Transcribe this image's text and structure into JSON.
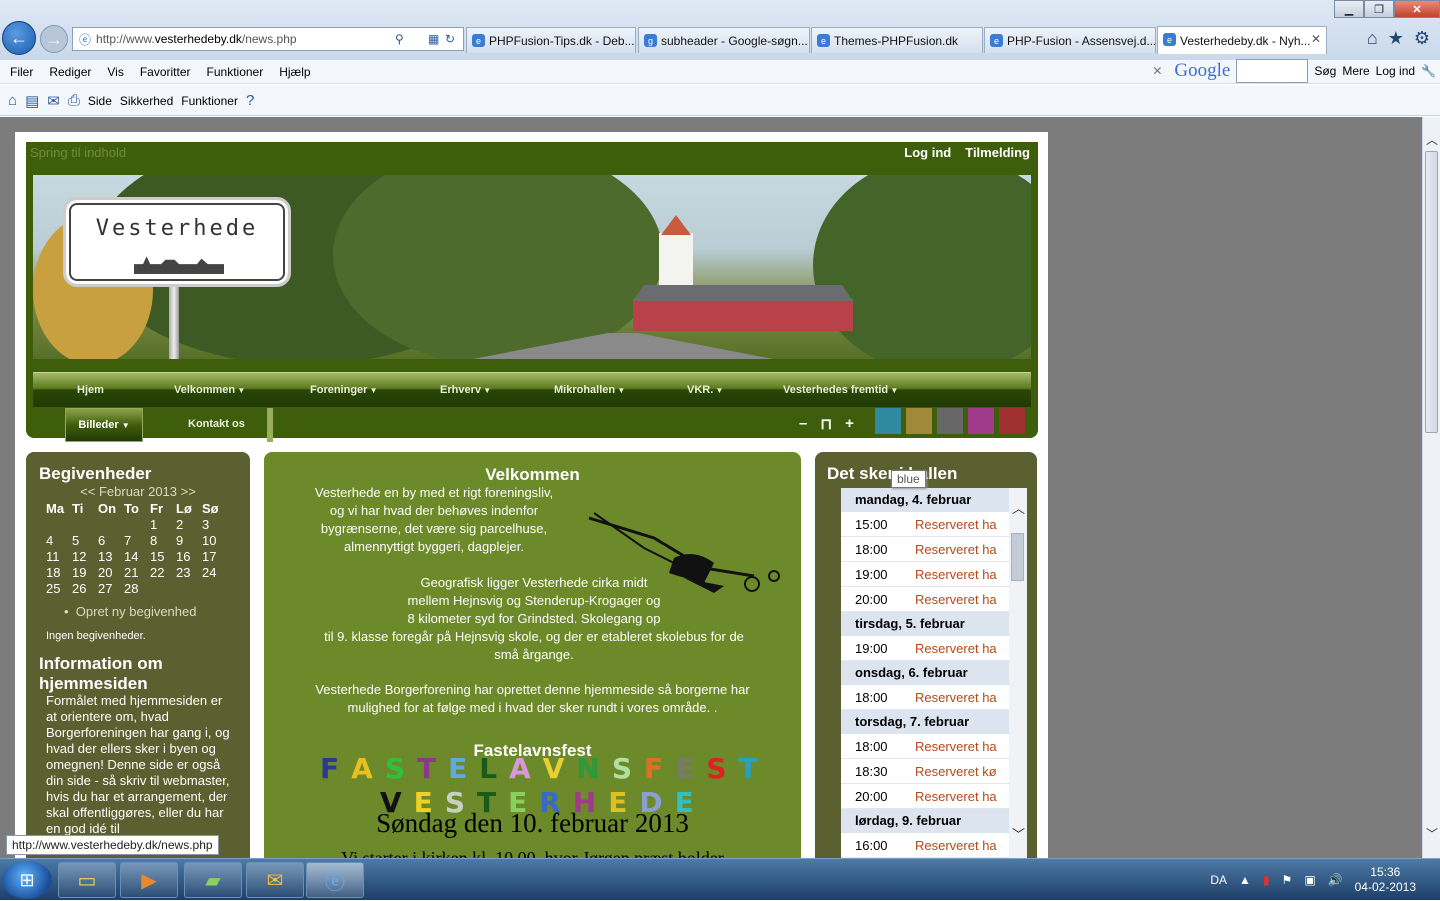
{
  "browser": {
    "address": {
      "prefix": "http://www.",
      "host": "vesterhedeby.dk",
      "path": "/news.php"
    },
    "tabs": [
      {
        "label": "PHPFusion-Tips.dk - Deb...",
        "icon": "ie-page-icon",
        "active": false
      },
      {
        "label": "subheader - Google-søgn...",
        "icon": "google-icon",
        "active": false
      },
      {
        "label": "Themes-PHPFusion.dk",
        "icon": "ie-page-icon",
        "active": false
      },
      {
        "label": "PHP-Fusion - Assensvej.d...",
        "icon": "php-fusion-icon",
        "active": false
      },
      {
        "label": "Vesterhedeby.dk - Nyh...",
        "icon": "ie-page-icon",
        "active": true
      }
    ],
    "menu": [
      "Filer",
      "Rediger",
      "Vis",
      "Favoritter",
      "Funktioner",
      "Hjælp"
    ],
    "google_bar": {
      "logo": "Google",
      "search": "Søg",
      "more": "Mere",
      "login": "Log ind"
    },
    "command_bar": [
      "Side",
      "Sikkerhed",
      "Funktioner"
    ],
    "status_url": "http://www.vesterhedeby.dk/news.php",
    "tooltip": "blue"
  },
  "site": {
    "skip_link": "Spring til indhold",
    "login": "Log ind",
    "register": "Tilmelding",
    "sign_text": "Vesterhede",
    "nav": [
      "Hjem",
      "Velkommen",
      "Foreninger",
      "Erhverv",
      "Mikrohallen",
      "VKR.",
      "Vesterhedes fremtid"
    ],
    "nav2": [
      "Billeder",
      "Kontakt os"
    ],
    "font_controls": [
      "–",
      "⊓",
      "+"
    ],
    "swatches": [
      "#2f8aa0",
      "#a08a3a",
      "#666666",
      "#a03a8a",
      "#a03030"
    ]
  },
  "left": {
    "events_title": "Begivenheder",
    "cal_nav": "<< Februar 2013 >>",
    "weekdays": [
      "Ma",
      "Ti",
      "On",
      "To",
      "Fr",
      "Lø",
      "Sø"
    ],
    "weeks": [
      [
        "",
        "",
        "",
        "",
        "1",
        "2",
        "3"
      ],
      [
        "4",
        "5",
        "6",
        "7",
        "8",
        "9",
        "10"
      ],
      [
        "11",
        "12",
        "13",
        "14",
        "15",
        "16",
        "17"
      ],
      [
        "18",
        "19",
        "20",
        "21",
        "22",
        "23",
        "24"
      ],
      [
        "25",
        "26",
        "27",
        "28",
        "",
        "",
        ""
      ]
    ],
    "new_event": "Opret ny begivenhed",
    "no_events": "Ingen begivenheder.",
    "info_title": "Information om hjemmesiden",
    "info_text": "Formålet med hjemmesiden er at orientere om, hvad Borgerforeningen har gang i, og hvad der ellers sker i byen og omegnen! Denne side er også din side - så skriv til webmaster, hvis du har et arrangement, der skal offentliggøres, eller du har en god idé til"
  },
  "center": {
    "title": "Velkommen",
    "p1": [
      "Vesterhede en by med et rigt foreningsliv,",
      "og vi har hvad der behøves indenfor",
      "bygrænserne, det være sig parcelhuse,",
      "almennyttigt byggeri, dagplejer."
    ],
    "p2": [
      "Geografisk ligger Vesterhede cirka midt",
      "mellem Hejnsvig og Stenderup-Krogager og",
      "8 kilometer syd for Grindsted. Skolegang op",
      "til 9. klasse foregår på Hejnsvig skole, og der er etableret skolebus for de",
      "små årgange."
    ],
    "p3": [
      "Vesterhede Borgerforening har oprettet denne hjemmeside så borgerne har",
      "mulighed for at følge med i hvad der sker rundt i vores område. ."
    ],
    "fest_heading": "Fastelavnsfest",
    "fest_line1": [
      {
        "c": "F",
        "col": "#2b3a8c"
      },
      {
        "c": "A",
        "col": "#e8c020"
      },
      {
        "c": "S",
        "col": "#30c040"
      },
      {
        "c": "T",
        "col": "#8a3a8a"
      },
      {
        "c": "E",
        "col": "#60a8e0"
      },
      {
        "c": "L",
        "col": "#1a5a1a"
      },
      {
        "c": "A",
        "col": "#d898d8"
      },
      {
        "c": "V",
        "col": "#e8d030"
      },
      {
        "c": "N",
        "col": "#2a9a3a"
      },
      {
        "c": "S",
        "col": "#b0e0a0"
      },
      {
        "c": "F",
        "col": "#e07020"
      },
      {
        "c": "E",
        "col": "#7a7a6a"
      },
      {
        "c": "S",
        "col": "#e02020"
      },
      {
        "c": "T",
        "col": "#2aa0c0"
      }
    ],
    "fest_line2": [
      {
        "c": "V",
        "col": "#111111"
      },
      {
        "c": "E",
        "col": "#f0d020"
      },
      {
        "c": "S",
        "col": "#c8d0c0"
      },
      {
        "c": "T",
        "col": "#1a5a1a"
      },
      {
        "c": "E",
        "col": "#8ad060"
      },
      {
        "c": "R",
        "col": "#3a6ac8"
      },
      {
        "c": "H",
        "col": "#a03a8a"
      },
      {
        "c": "E",
        "col": "#e0c020"
      },
      {
        "c": "D",
        "col": "#8aa0d0"
      },
      {
        "c": "E",
        "col": "#30c0c0"
      }
    ],
    "date_line": "Søndag den 10. februar 2013",
    "church_line": "Vi starter i kirken kl. 10.00, hvor Jørgen præst holder"
  },
  "right": {
    "title": "Det sker i hallen",
    "schedule": [
      {
        "day": "mandag, 4. februar",
        "slots": [
          {
            "t": "15:00",
            "w": "Reserveret ha"
          },
          {
            "t": "18:00",
            "w": "Reserveret ha"
          },
          {
            "t": "19:00",
            "w": "Reserveret ha"
          },
          {
            "t": "20:00",
            "w": "Reserveret ha"
          }
        ]
      },
      {
        "day": "tirsdag, 5. februar",
        "slots": [
          {
            "t": "19:00",
            "w": "Reserveret ha"
          }
        ]
      },
      {
        "day": "onsdag, 6. februar",
        "slots": [
          {
            "t": "18:00",
            "w": "Reserveret ha"
          }
        ]
      },
      {
        "day": "torsdag, 7. februar",
        "slots": [
          {
            "t": "18:00",
            "w": "Reserveret ha"
          },
          {
            "t": "18:30",
            "w": "Reserveret kø"
          },
          {
            "t": "20:00",
            "w": "Reserveret ha"
          }
        ]
      },
      {
        "day": "lørdag, 9. februar",
        "slots": [
          {
            "t": "16:00",
            "w": "Reserveret ha"
          }
        ]
      }
    ]
  },
  "taskbar": {
    "lang": "DA",
    "time": "15:36",
    "date": "04-02-2013"
  }
}
